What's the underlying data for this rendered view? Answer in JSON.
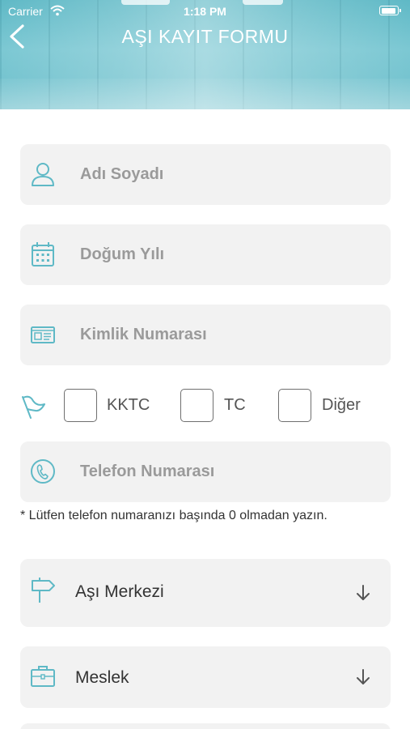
{
  "status_bar": {
    "carrier": "Carrier",
    "time": "1:18 PM"
  },
  "header": {
    "title": "AŞI KAYIT FORMU"
  },
  "form": {
    "full_name_placeholder": "Adı Soyadı",
    "birth_year_placeholder": "Doğum Yılı",
    "id_number_placeholder": "Kimlik Numarası",
    "nationality_options": [
      "KKTC",
      "TC",
      "Diğer"
    ],
    "phone_placeholder": "Telefon Numarası",
    "phone_note": "* Lütfen telefon numaranızı başında 0 olmadan yazın.",
    "vaccine_center_label": "Aşı Merkezi",
    "profession_label": "Meslek"
  },
  "colors": {
    "accent": "#5fb9c6",
    "field_bg": "#f2f2f2",
    "placeholder": "#9a9a9a"
  },
  "icons": [
    "back-chevron-icon",
    "wifi-icon",
    "battery-icon",
    "person-icon",
    "calendar-icon",
    "id-card-icon",
    "flag-icon",
    "phone-icon",
    "signpost-icon",
    "briefcase-icon",
    "arrow-down-icon"
  ]
}
